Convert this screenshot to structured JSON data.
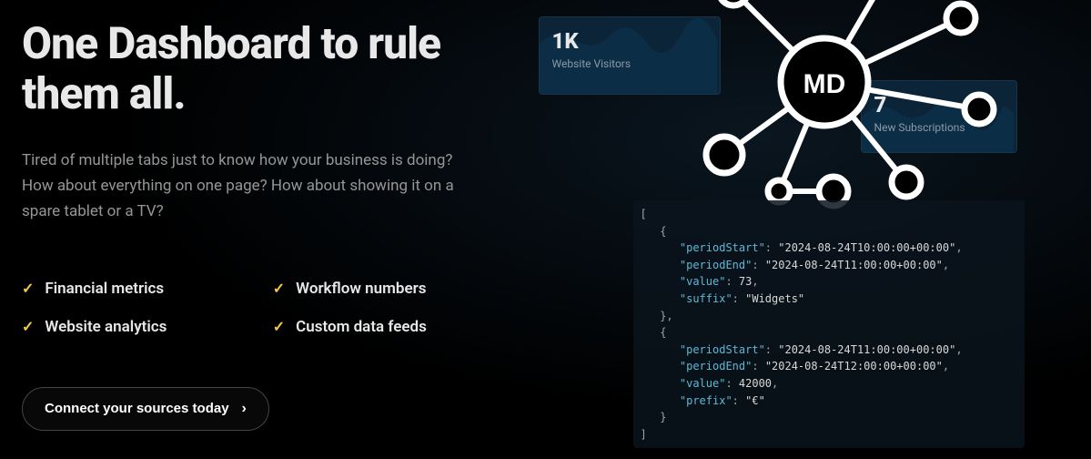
{
  "headline": "One Dashboard to rule them all.",
  "subtext": "Tired of multiple tabs just to know how your business is doing? How about everything on one page? How about showing it on a spare tablet or a TV?",
  "features": [
    "Financial metrics",
    "Workflow numbers",
    "Website analytics",
    "Custom data feeds"
  ],
  "cta_label": "Connect your sources today",
  "cards": {
    "visitors": {
      "metric": "1K",
      "label": "Website Visitors"
    },
    "subs": {
      "metric": "7",
      "label": "New Subscriptions"
    }
  },
  "logo_text": "MD",
  "code_sample": {
    "items": [
      {
        "periodStart": "2024-08-24T10:00:00+00:00",
        "periodEnd": "2024-08-24T11:00:00+00:00",
        "value": "73",
        "extraKey": "suffix",
        "extraVal": "Widgets"
      },
      {
        "periodStart": "2024-08-24T11:00:00+00:00",
        "periodEnd": "2024-08-24T12:00:00+00:00",
        "value": "42000",
        "extraKey": "prefix",
        "extraVal": "€"
      }
    ]
  }
}
